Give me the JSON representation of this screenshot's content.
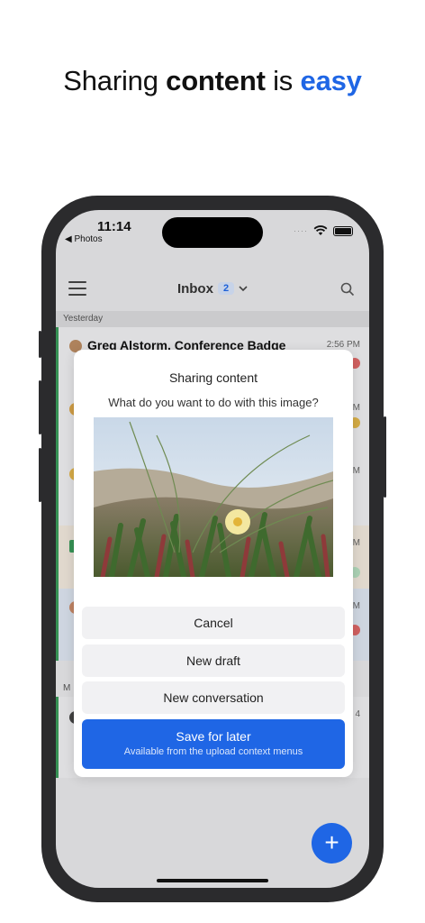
{
  "headline": {
    "part1": "Sharing ",
    "part2": "content",
    "part3": " is ",
    "part4": "easy"
  },
  "status_bar": {
    "time": "11:14",
    "back_label": "◀ Photos",
    "signal": "····"
  },
  "app_bar": {
    "title": "Inbox",
    "count": "2"
  },
  "list": {
    "section_yesterday": "Yesterday",
    "section_second": "M",
    "first_row": {
      "sender": "Greg Alstorm, Conference Badge",
      "time": "2:56 PM"
    },
    "partial_times": [
      "M",
      "M",
      "M",
      "M",
      "4"
    ]
  },
  "dialog": {
    "title": "Sharing content",
    "question": "What do you want to do with this image?",
    "actions": {
      "cancel": "Cancel",
      "new_draft": "New draft",
      "new_conversation": "New conversation",
      "save_for_later": "Save for later",
      "save_for_later_sub": "Available from the upload context menus"
    }
  },
  "fab": {
    "icon": "plus-icon",
    "label": "+"
  },
  "colors": {
    "accent": "#1f66e5",
    "unread_bar": "#3a9b5a"
  }
}
